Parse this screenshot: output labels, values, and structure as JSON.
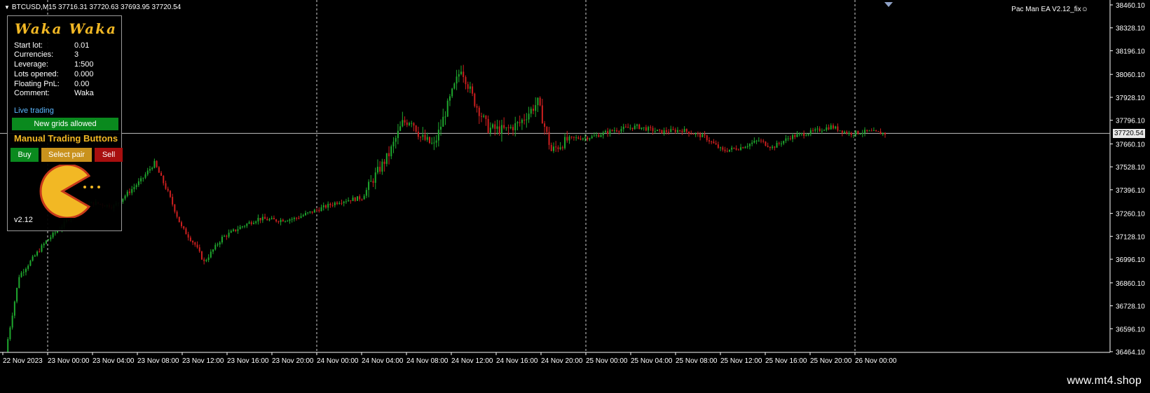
{
  "window": {
    "symbol_info": "BTCUSD,M15  37716.31 37720.63 37693.95 37720.54",
    "ea_label": "Pac Man EA  V2.12_fix☺",
    "current_price": "37720.54",
    "watermark": "www.mt4.shop"
  },
  "panel": {
    "logo": "Waka Waka",
    "rows": [
      {
        "key": "Start lot:",
        "value": "0.01"
      },
      {
        "key": "Currencies:",
        "value": "3"
      },
      {
        "key": "Leverage:",
        "value": "1:500"
      },
      {
        "key": "Lots opened:",
        "value": "0.000"
      },
      {
        "key": "Floating PnL:",
        "value": "0.00"
      },
      {
        "key": "Comment:",
        "value": "Waka"
      }
    ],
    "status": "Live trading",
    "grids_button": "New grids allowed",
    "manual_title": "Manual Trading Buttons",
    "buy_label": "Buy",
    "pair_label": "Select pair",
    "sell_label": "Sell",
    "version": "v2.12",
    "colors": {
      "accent": "#f2b824",
      "buy": "#0a8a1e",
      "pair": "#c9921d",
      "sell": "#a80f0f",
      "status": "#5cb8ff"
    }
  },
  "chart_data": {
    "type": "line",
    "title": "",
    "symbol": "BTCUSD",
    "timeframe": "M15",
    "y_ticks": [
      "38460.10",
      "38328.10",
      "38196.10",
      "38060.10",
      "37928.10",
      "37796.10",
      "37660.10",
      "37528.10",
      "37396.10",
      "37260.10",
      "37128.10",
      "36996.10",
      "36860.10",
      "36728.10",
      "36596.10",
      "36464.10"
    ],
    "x_ticks": [
      "22 Nov 2023",
      "23 Nov 00:00",
      "23 Nov 04:00",
      "23 Nov 08:00",
      "23 Nov 12:00",
      "23 Nov 16:00",
      "23 Nov 20:00",
      "24 Nov 00:00",
      "24 Nov 04:00",
      "24 Nov 08:00",
      "24 Nov 12:00",
      "24 Nov 16:00",
      "24 Nov 20:00",
      "25 Nov 00:00",
      "25 Nov 04:00",
      "25 Nov 08:00",
      "25 Nov 12:00",
      "25 Nov 16:00",
      "25 Nov 20:00",
      "26 Nov 00:00"
    ],
    "ylim": [
      36464.1,
      38460.1
    ],
    "grid": "day separators",
    "bull_color": "#1fa82e",
    "bear_color": "#cc1f1f",
    "approx_close_path": [
      [
        0,
        36464
      ],
      [
        6,
        36900
      ],
      [
        18,
        37100
      ],
      [
        26,
        37200
      ],
      [
        32,
        37300
      ],
      [
        39,
        37320
      ],
      [
        48,
        37300
      ],
      [
        60,
        37450
      ],
      [
        66,
        37550
      ],
      [
        72,
        37380
      ],
      [
        78,
        37180
      ],
      [
        84,
        37080
      ],
      [
        88,
        36980
      ],
      [
        92,
        37050
      ],
      [
        96,
        37120
      ],
      [
        104,
        37180
      ],
      [
        112,
        37230
      ],
      [
        120,
        37220
      ],
      [
        128,
        37230
      ],
      [
        134,
        37260
      ],
      [
        140,
        37290
      ],
      [
        148,
        37330
      ],
      [
        158,
        37350
      ],
      [
        164,
        37480
      ],
      [
        170,
        37600
      ],
      [
        176,
        37780
      ],
      [
        180,
        37800
      ],
      [
        184,
        37700
      ],
      [
        190,
        37650
      ],
      [
        196,
        37880
      ],
      [
        202,
        38100
      ],
      [
        208,
        37900
      ],
      [
        214,
        37750
      ],
      [
        222,
        37740
      ],
      [
        228,
        37780
      ],
      [
        236,
        37900
      ],
      [
        242,
        37620
      ],
      [
        250,
        37690
      ],
      [
        260,
        37700
      ],
      [
        270,
        37740
      ],
      [
        280,
        37760
      ],
      [
        290,
        37730
      ],
      [
        300,
        37740
      ],
      [
        310,
        37700
      ],
      [
        318,
        37620
      ],
      [
        326,
        37640
      ],
      [
        334,
        37680
      ],
      [
        340,
        37640
      ],
      [
        348,
        37700
      ],
      [
        358,
        37730
      ],
      [
        366,
        37760
      ],
      [
        374,
        37720
      ],
      [
        382,
        37730
      ],
      [
        390,
        37720
      ]
    ]
  }
}
